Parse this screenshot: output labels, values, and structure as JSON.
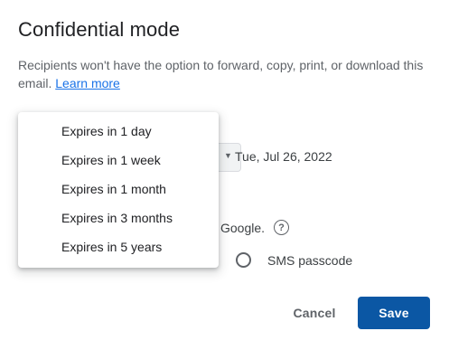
{
  "dialog": {
    "title": "Confidential mode",
    "description": "Recipients won't have the option to forward, copy, print, or download this email.",
    "learn_more": "Learn more"
  },
  "expiry": {
    "date": "Tue, Jul 26, 2022",
    "options": [
      {
        "label": "Expires in 1 day"
      },
      {
        "label": "Expires in 1 week"
      },
      {
        "label": "Expires in 1 month"
      },
      {
        "label": "Expires in 3 months"
      },
      {
        "label": "Expires in 5 years"
      }
    ]
  },
  "passcode": {
    "hint_fragment": "Google.",
    "sms_label": "SMS passcode"
  },
  "actions": {
    "cancel_label": "Cancel",
    "save_label": "Save"
  },
  "colors": {
    "primary": "#0b57a4",
    "link": "#1a73e8"
  },
  "icons": {
    "help": "help-circle-icon",
    "caret": "chevron-down-icon"
  }
}
